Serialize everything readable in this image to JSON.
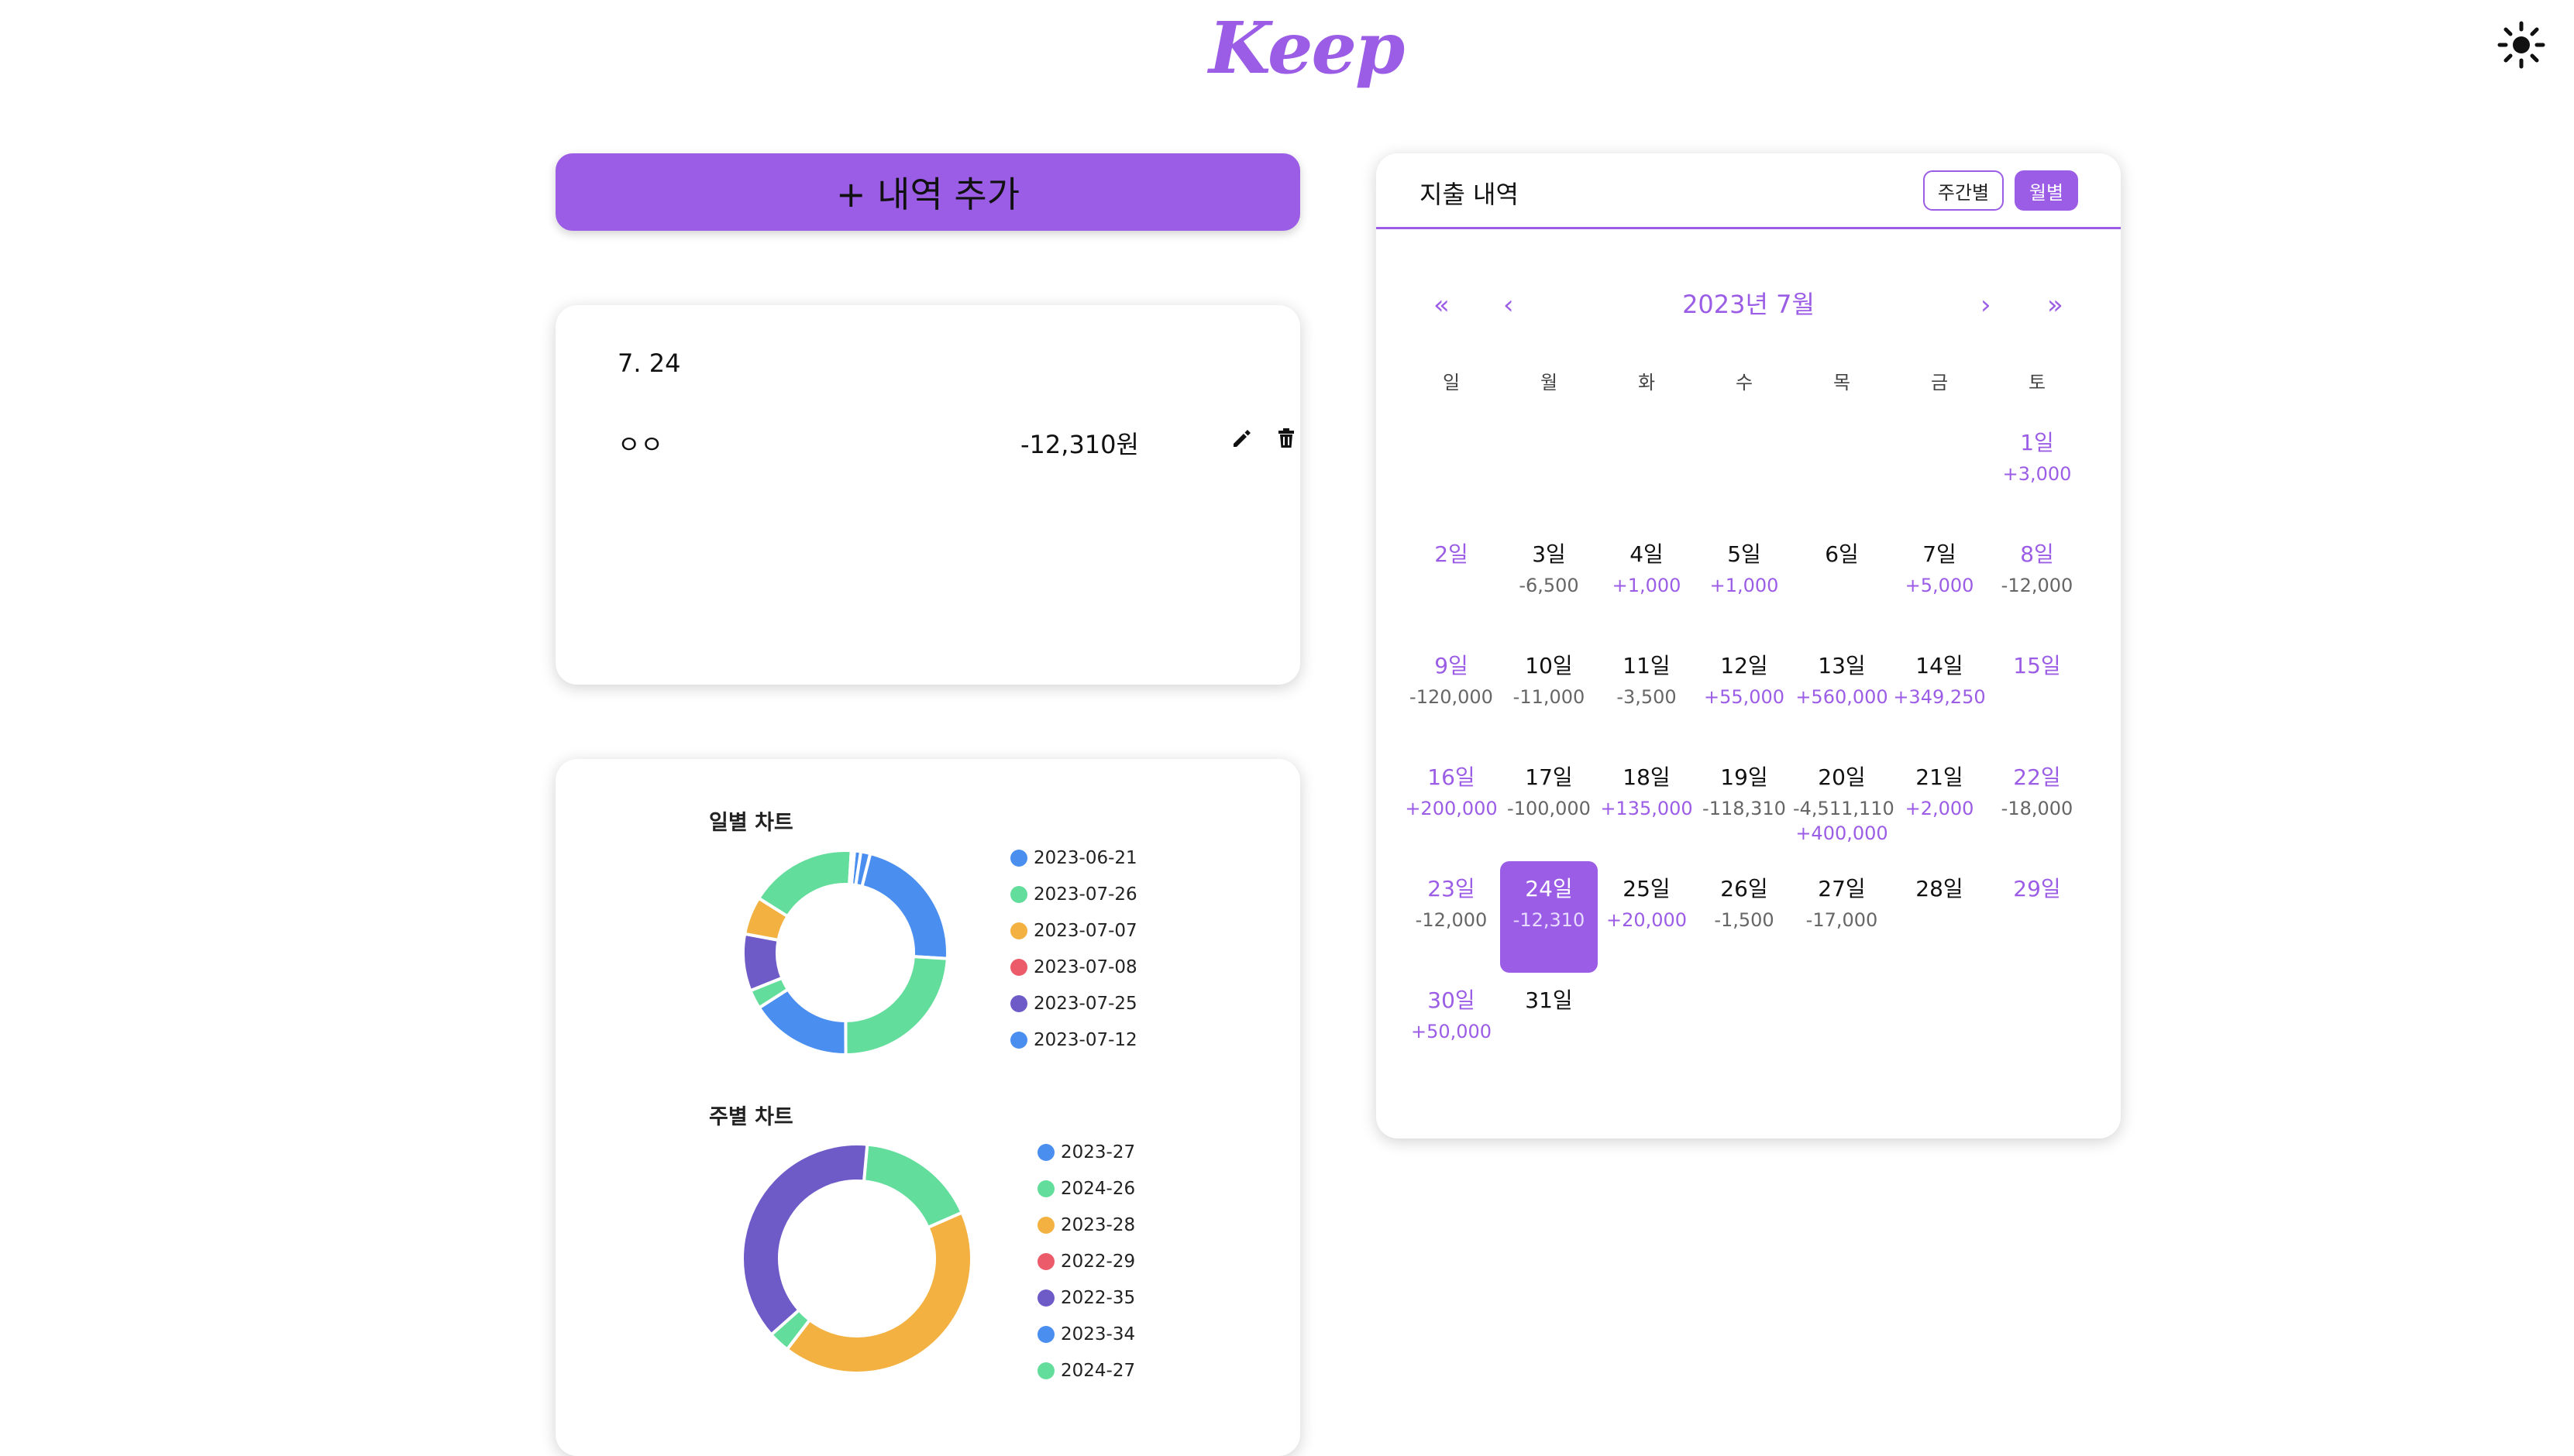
{
  "app": {
    "logo": "Keep"
  },
  "icons": {
    "theme": "sun-icon",
    "edit": "pencil-icon",
    "delete": "trash-icon"
  },
  "colors": {
    "accent": "#9b5de5",
    "income": "#9b5de5",
    "expense": "#666666"
  },
  "add_button": {
    "label": "+ 내역 추가"
  },
  "detail": {
    "date": "7. 24",
    "items": [
      {
        "memo": "ㅇㅇ",
        "amount": "-12,310원"
      }
    ]
  },
  "charts": {
    "daily_title": "일별 차트",
    "weekly_title": "주별 차트"
  },
  "chart_data": [
    {
      "type": "pie",
      "title": "일별 차트",
      "legend_entries": [
        {
          "label": "2023-06-21",
          "color": "#4a8ff0"
        },
        {
          "label": "2023-07-26",
          "color": "#63dd9b"
        },
        {
          "label": "2023-07-07",
          "color": "#f2b141"
        },
        {
          "label": "2023-07-08",
          "color": "#ec5b6a"
        },
        {
          "label": "2023-07-25",
          "color": "#6e5bc8"
        },
        {
          "label": "2023-07-12",
          "color": "#4a8ff0"
        }
      ],
      "slices": [
        {
          "color": "#4a8ff0",
          "value": 1
        },
        {
          "color": "#4a8ff0",
          "value": 1.5
        },
        {
          "color": "#4a8ff0",
          "value": 22
        },
        {
          "color": "#63dd9b",
          "value": 24
        },
        {
          "color": "#4a8ff0",
          "value": 16
        },
        {
          "color": "#63dd9b",
          "value": 3
        },
        {
          "color": "#6e5bc8",
          "value": 9
        },
        {
          "color": "#f2b141",
          "value": 6
        },
        {
          "color": "#63dd9b",
          "value": 17
        },
        {
          "color": "#4a8ff0",
          "value": 0.5
        }
      ]
    },
    {
      "type": "pie",
      "title": "주별 차트",
      "legend_entries": [
        {
          "label": "2023-27",
          "color": "#4a8ff0"
        },
        {
          "label": "2024-26",
          "color": "#63dd9b"
        },
        {
          "label": "2023-28",
          "color": "#f2b141"
        },
        {
          "label": "2022-29",
          "color": "#ec5b6a"
        },
        {
          "label": "2022-35",
          "color": "#6e5bc8"
        },
        {
          "label": "2023-34",
          "color": "#4a8ff0"
        },
        {
          "label": "2024-27",
          "color": "#63dd9b"
        }
      ],
      "slices": [
        {
          "color": "#63dd9b",
          "value": 17
        },
        {
          "color": "#f2b141",
          "value": 42
        },
        {
          "color": "#63dd9b",
          "value": 3
        },
        {
          "color": "#6e5bc8",
          "value": 38
        }
      ]
    }
  ],
  "calendar": {
    "title": "지출 내역",
    "toggle_week": "주간별",
    "toggle_month": "월별",
    "month_label": "2023년 7월",
    "nav": {
      "prev_year": "«",
      "prev": "‹",
      "next": "›",
      "next_year": "»"
    },
    "weekdays": [
      "일",
      "월",
      "화",
      "수",
      "목",
      "금",
      "토"
    ],
    "days": [
      {
        "label": "1일",
        "amount": "+3,000",
        "col": 6,
        "row": 0,
        "tone": "purple",
        "atone": "purple"
      },
      {
        "label": "2일",
        "amount": "",
        "col": 0,
        "row": 1,
        "tone": "purple"
      },
      {
        "label": "3일",
        "amount": "-6,500",
        "col": 1,
        "row": 1,
        "tone": "black",
        "atone": "gray"
      },
      {
        "label": "4일",
        "amount": "+1,000",
        "col": 2,
        "row": 1,
        "tone": "black",
        "atone": "purple"
      },
      {
        "label": "5일",
        "amount": "+1,000",
        "col": 3,
        "row": 1,
        "tone": "black",
        "atone": "purple"
      },
      {
        "label": "6일",
        "amount": "",
        "col": 4,
        "row": 1,
        "tone": "black"
      },
      {
        "label": "7일",
        "amount": "+5,000",
        "col": 5,
        "row": 1,
        "tone": "black",
        "atone": "purple"
      },
      {
        "label": "8일",
        "amount": "-12,000",
        "col": 6,
        "row": 1,
        "tone": "purple",
        "atone": "gray"
      },
      {
        "label": "9일",
        "amount": "-120,000",
        "col": 0,
        "row": 2,
        "tone": "purple",
        "atone": "gray"
      },
      {
        "label": "10일",
        "amount": "-11,000",
        "col": 1,
        "row": 2,
        "tone": "black",
        "atone": "gray"
      },
      {
        "label": "11일",
        "amount": "-3,500",
        "col": 2,
        "row": 2,
        "tone": "black",
        "atone": "gray"
      },
      {
        "label": "12일",
        "amount": "+55,000",
        "col": 3,
        "row": 2,
        "tone": "black",
        "atone": "purple"
      },
      {
        "label": "13일",
        "amount": "+560,000",
        "col": 4,
        "row": 2,
        "tone": "black",
        "atone": "purple"
      },
      {
        "label": "14일",
        "amount": "+349,250",
        "col": 5,
        "row": 2,
        "tone": "black",
        "atone": "purple"
      },
      {
        "label": "15일",
        "amount": "",
        "col": 6,
        "row": 2,
        "tone": "purple"
      },
      {
        "label": "16일",
        "amount": "+200,000",
        "col": 0,
        "row": 3,
        "tone": "purple",
        "atone": "purple"
      },
      {
        "label": "17일",
        "amount": "-100,000",
        "col": 1,
        "row": 3,
        "tone": "black",
        "atone": "gray"
      },
      {
        "label": "18일",
        "amount": "+135,000",
        "col": 2,
        "row": 3,
        "tone": "black",
        "atone": "purple"
      },
      {
        "label": "19일",
        "amount": "-118,310",
        "col": 3,
        "row": 3,
        "tone": "black",
        "atone": "gray"
      },
      {
        "label": "20일",
        "amount": "-4,511,110",
        "amount2": "+400,000",
        "col": 4,
        "row": 3,
        "tone": "black",
        "atone": "gray"
      },
      {
        "label": "21일",
        "amount": "+2,000",
        "col": 5,
        "row": 3,
        "tone": "black",
        "atone": "purple"
      },
      {
        "label": "22일",
        "amount": "-18,000",
        "col": 6,
        "row": 3,
        "tone": "purple",
        "atone": "gray"
      },
      {
        "label": "23일",
        "amount": "-12,000",
        "col": 0,
        "row": 4,
        "tone": "purple",
        "atone": "gray"
      },
      {
        "label": "24일",
        "amount": "-12,310",
        "col": 1,
        "row": 4,
        "tone": "black",
        "atone": "gray",
        "selected": true
      },
      {
        "label": "25일",
        "amount": "+20,000",
        "col": 2,
        "row": 4,
        "tone": "black",
        "atone": "purple"
      },
      {
        "label": "26일",
        "amount": "-1,500",
        "col": 3,
        "row": 4,
        "tone": "black",
        "atone": "gray"
      },
      {
        "label": "27일",
        "amount": "-17,000",
        "col": 4,
        "row": 4,
        "tone": "black",
        "atone": "gray"
      },
      {
        "label": "28일",
        "amount": "",
        "col": 5,
        "row": 4,
        "tone": "black"
      },
      {
        "label": "29일",
        "amount": "",
        "col": 6,
        "row": 4,
        "tone": "purple"
      },
      {
        "label": "30일",
        "amount": "+50,000",
        "col": 0,
        "row": 5,
        "tone": "purple",
        "atone": "purple"
      },
      {
        "label": "31일",
        "amount": "",
        "col": 1,
        "row": 5,
        "tone": "black"
      }
    ]
  }
}
